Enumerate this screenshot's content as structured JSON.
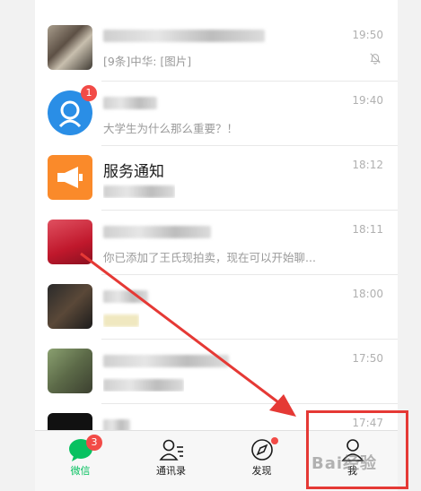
{
  "chats": [
    {
      "name": "",
      "preview": "[9条]中华: [图片]",
      "time": "19:50",
      "muted": true,
      "badge": ""
    },
    {
      "name": "",
      "preview": "大学生为什么那么重要？！",
      "time": "19:40",
      "muted": false,
      "badge": "1"
    },
    {
      "name": "服务通知",
      "preview": "",
      "time": "18:12",
      "muted": false,
      "badge": ""
    },
    {
      "name": "",
      "preview": "你已添加了王氏现拍卖，现在可以开始聊...",
      "time": "18:11",
      "muted": false,
      "badge": ""
    },
    {
      "name": "",
      "preview": "",
      "time": "18:00",
      "muted": false,
      "badge": ""
    },
    {
      "name": "",
      "preview": "",
      "time": "17:50",
      "muted": false,
      "badge": ""
    },
    {
      "name": "",
      "preview": "",
      "time": "17:47",
      "muted": false,
      "badge": ""
    }
  ],
  "tabs": [
    {
      "label": "微信",
      "badge": "3"
    },
    {
      "label": "通讯录"
    },
    {
      "label": "发现"
    },
    {
      "label": "我"
    }
  ],
  "watermark": "Bai经验",
  "colors": {
    "accent": "#07c160",
    "badge": "#f24b47",
    "annotation": "#e53935"
  }
}
